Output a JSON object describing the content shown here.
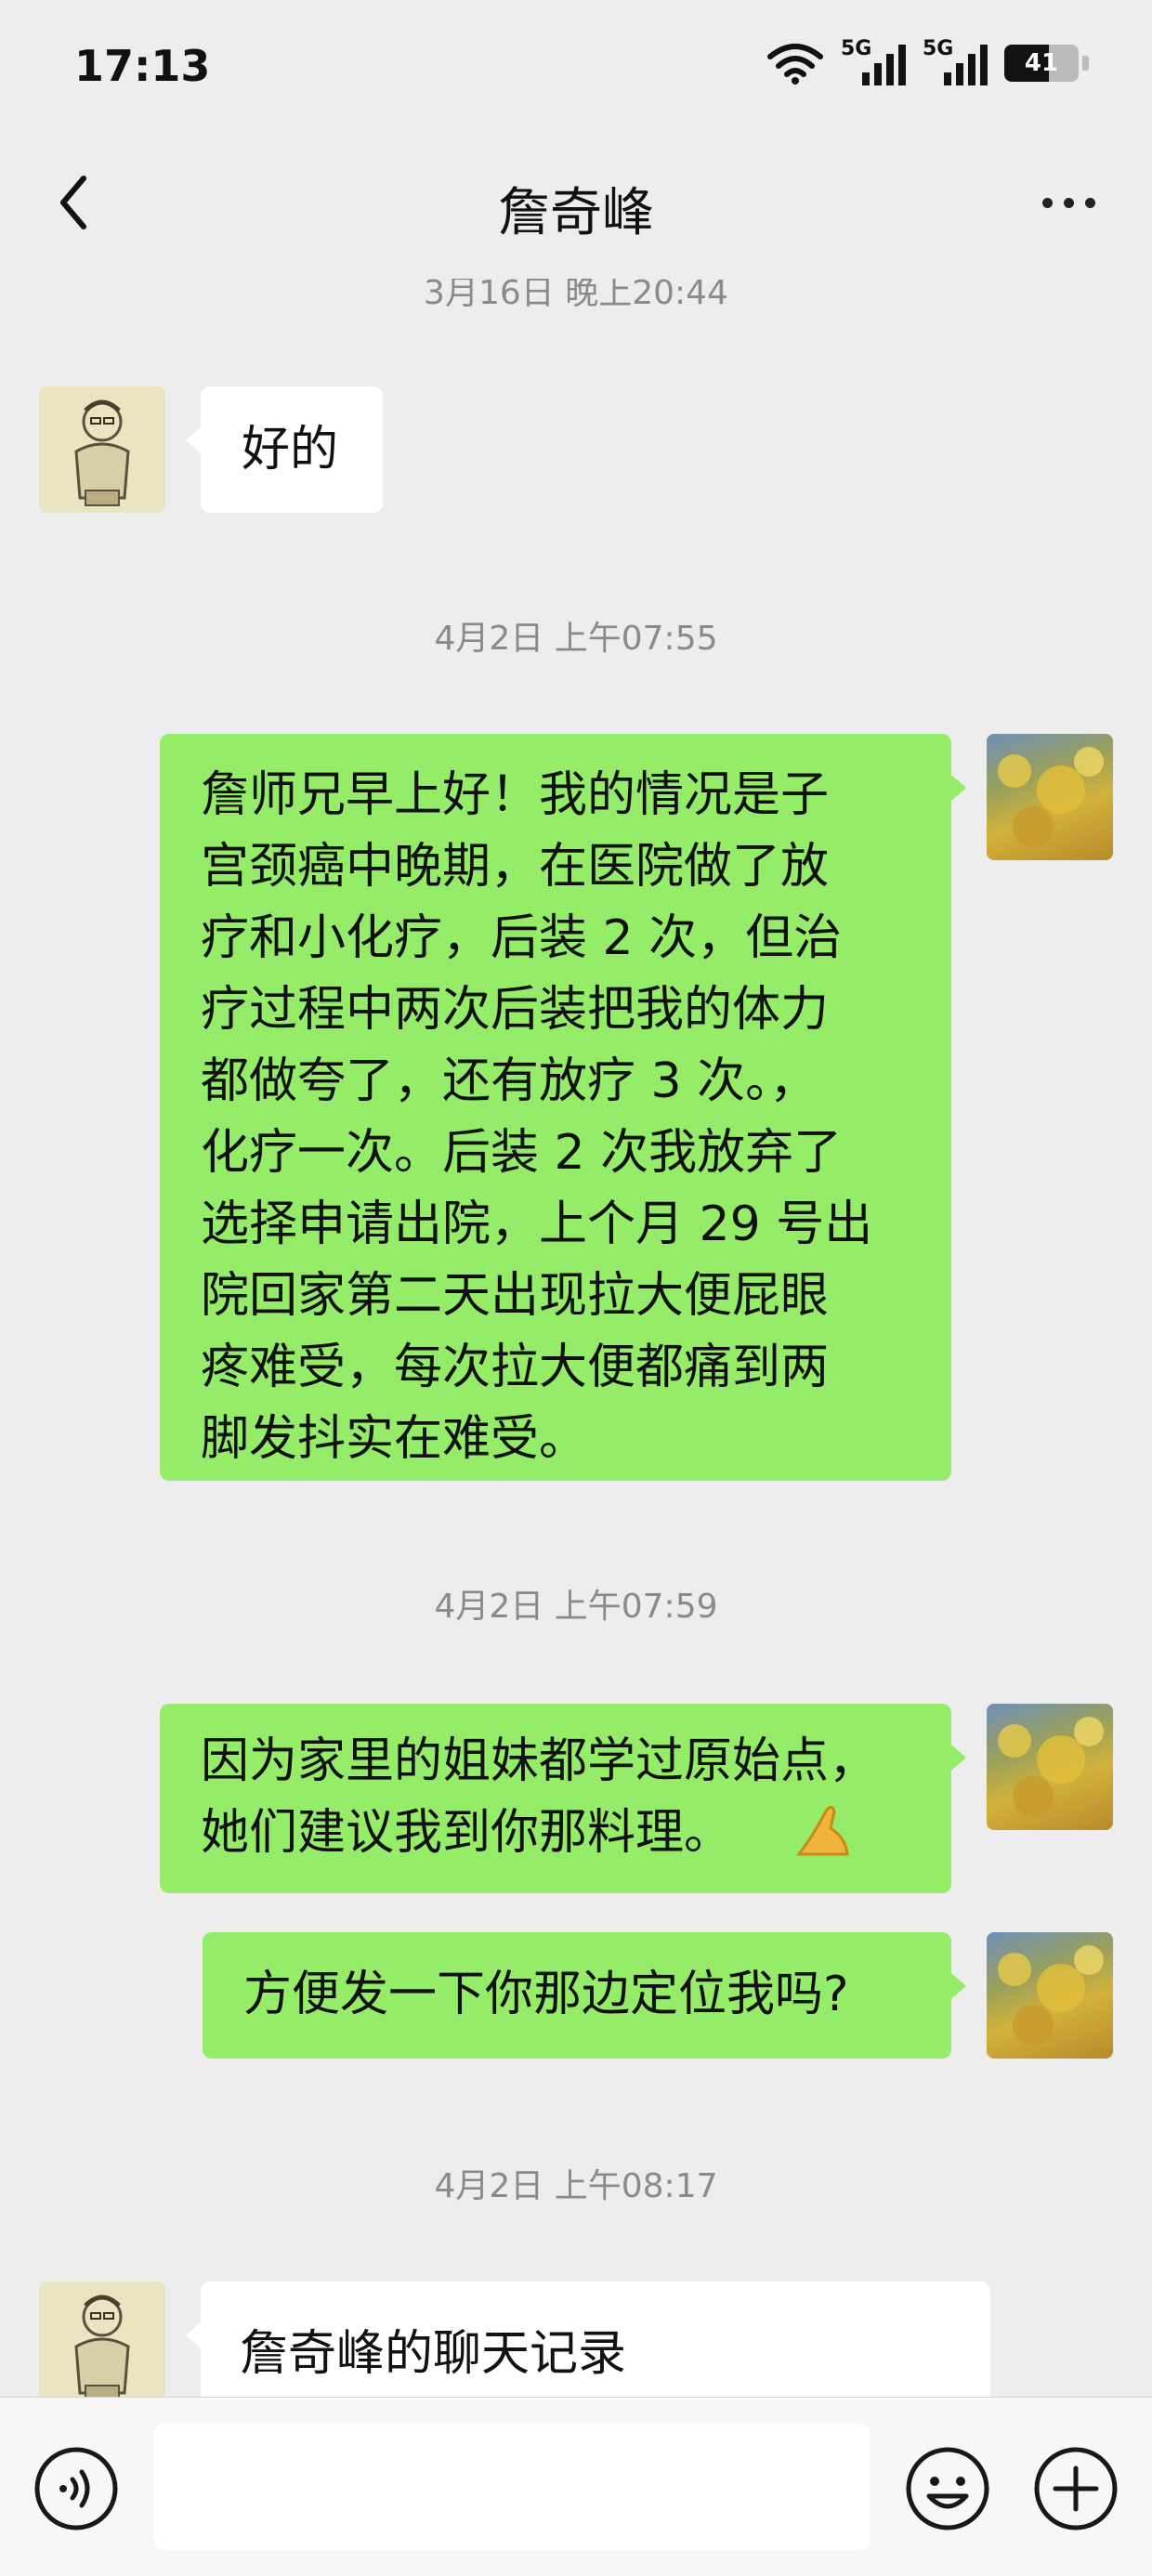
{
  "status_bar": {
    "time": "17:13",
    "signal_label_1": "5G",
    "signal_label_2": "5G",
    "battery": "41"
  },
  "header": {
    "title": "詹奇峰",
    "back_icon": "chevron-left-icon",
    "more_icon": "more-dots-icon"
  },
  "messages": {
    "ts0": "3月16日 晚上20:44",
    "m1": "好的",
    "ts1": "4月2日 上午07:55",
    "m2": "詹师兄早上好！我的情况是子\n宫颈癌中晚期，在医院做了放\n疗和小化疗，后装 2 次，但治\n疗过程中两次后装把我的体力\n都做夸了，还有放疗 3 次。，\n化疗一次。后装 2 次我放弃了\n选择申请出院，上个月 29 号出\n院回家第二天出现拉大便屁眼\n疼难受，每次拉大便都痛到两\n脚发抖实在难受。",
    "ts2": "4月2日 上午07:59",
    "m3": "因为家里的姐妹都学过原始点，\n她们建议我到你那料理。",
    "m4": "方便发一下你那边定位我吗?",
    "ts3": "4月2日 上午08:17",
    "m5": "詹奇峰的聊天记录"
  },
  "input_bar": {
    "placeholder": "",
    "voice_icon": "voice-icon",
    "emoji_icon": "emoji-icon",
    "plus_icon": "plus-icon"
  },
  "colors": {
    "background": "#ededed",
    "bubble_self": "#95ec69",
    "bubble_other": "#ffffff",
    "timestamp": "#8a8a8a"
  }
}
